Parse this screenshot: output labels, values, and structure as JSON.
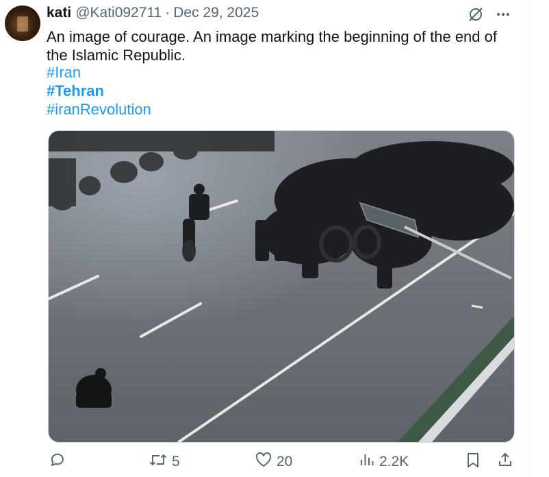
{
  "tweet": {
    "author_name": "kati",
    "handle": "@Kati092711",
    "separator": "·",
    "date": "Dec 29, 2025",
    "text": "An image of courage. An image marking the beginning of the end of the Islamic Republic.",
    "hashtags": [
      "#Iran",
      "#Tehran",
      "#iranRevolution"
    ]
  },
  "icons": {
    "grok": "grok-icon",
    "more": "more-icon",
    "reply": "reply-icon",
    "retweet": "retweet-icon",
    "like": "heart-icon",
    "views": "views-icon",
    "bookmark": "bookmark-icon",
    "share": "share-icon"
  },
  "actions": {
    "reply_count": "",
    "retweet_count": "5",
    "like_count": "20",
    "view_count": "2.2K"
  },
  "colors": {
    "link": "#1d9bf0",
    "secondary_text": "#536471",
    "primary_text": "#0f1419"
  }
}
